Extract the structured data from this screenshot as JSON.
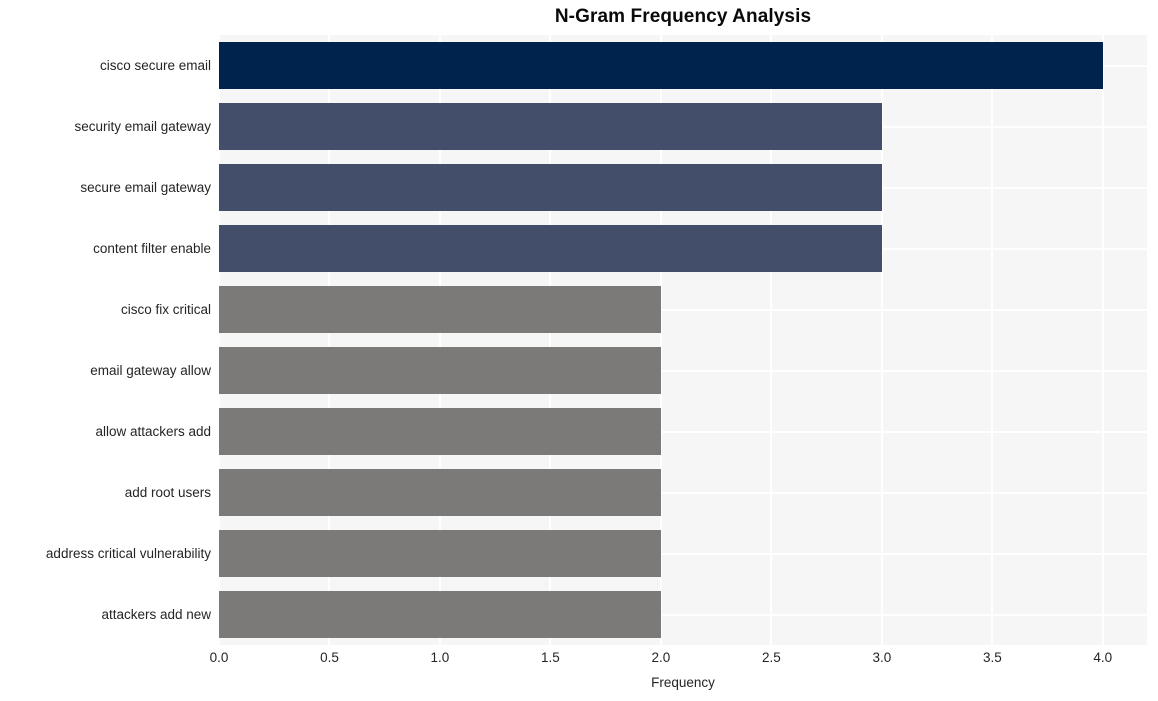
{
  "chart_data": {
    "type": "bar",
    "orientation": "horizontal",
    "title": "N-Gram Frequency Analysis",
    "xlabel": "Frequency",
    "ylabel": "",
    "xlim": [
      0,
      4.2
    ],
    "xticks": [
      "0.0",
      "0.5",
      "1.0",
      "1.5",
      "2.0",
      "2.5",
      "3.0",
      "3.5",
      "4.0"
    ],
    "xtick_values": [
      0.0,
      0.5,
      1.0,
      1.5,
      2.0,
      2.5,
      3.0,
      3.5,
      4.0
    ],
    "grid": true,
    "legend": "none",
    "categories": [
      "cisco secure email",
      "security email gateway",
      "secure email gateway",
      "content filter enable",
      "cisco fix critical",
      "email gateway allow",
      "allow attackers add",
      "add root users",
      "address critical vulnerability",
      "attackers add new"
    ],
    "values": [
      4,
      3,
      3,
      3,
      2,
      2,
      2,
      2,
      2,
      2
    ],
    "bar_colors": [
      "#00234e",
      "#434e6b",
      "#434e6b",
      "#434e6b",
      "#7b7a78",
      "#7b7a78",
      "#7b7a78",
      "#7b7a78",
      "#7b7a78",
      "#7b7a78"
    ]
  },
  "style": {
    "plot_background": "#f6f6f7",
    "figure_background": "#ffffff",
    "gridline_color": "#ffffff",
    "text_color": "#252525",
    "title_color": "#0a0a0a"
  }
}
